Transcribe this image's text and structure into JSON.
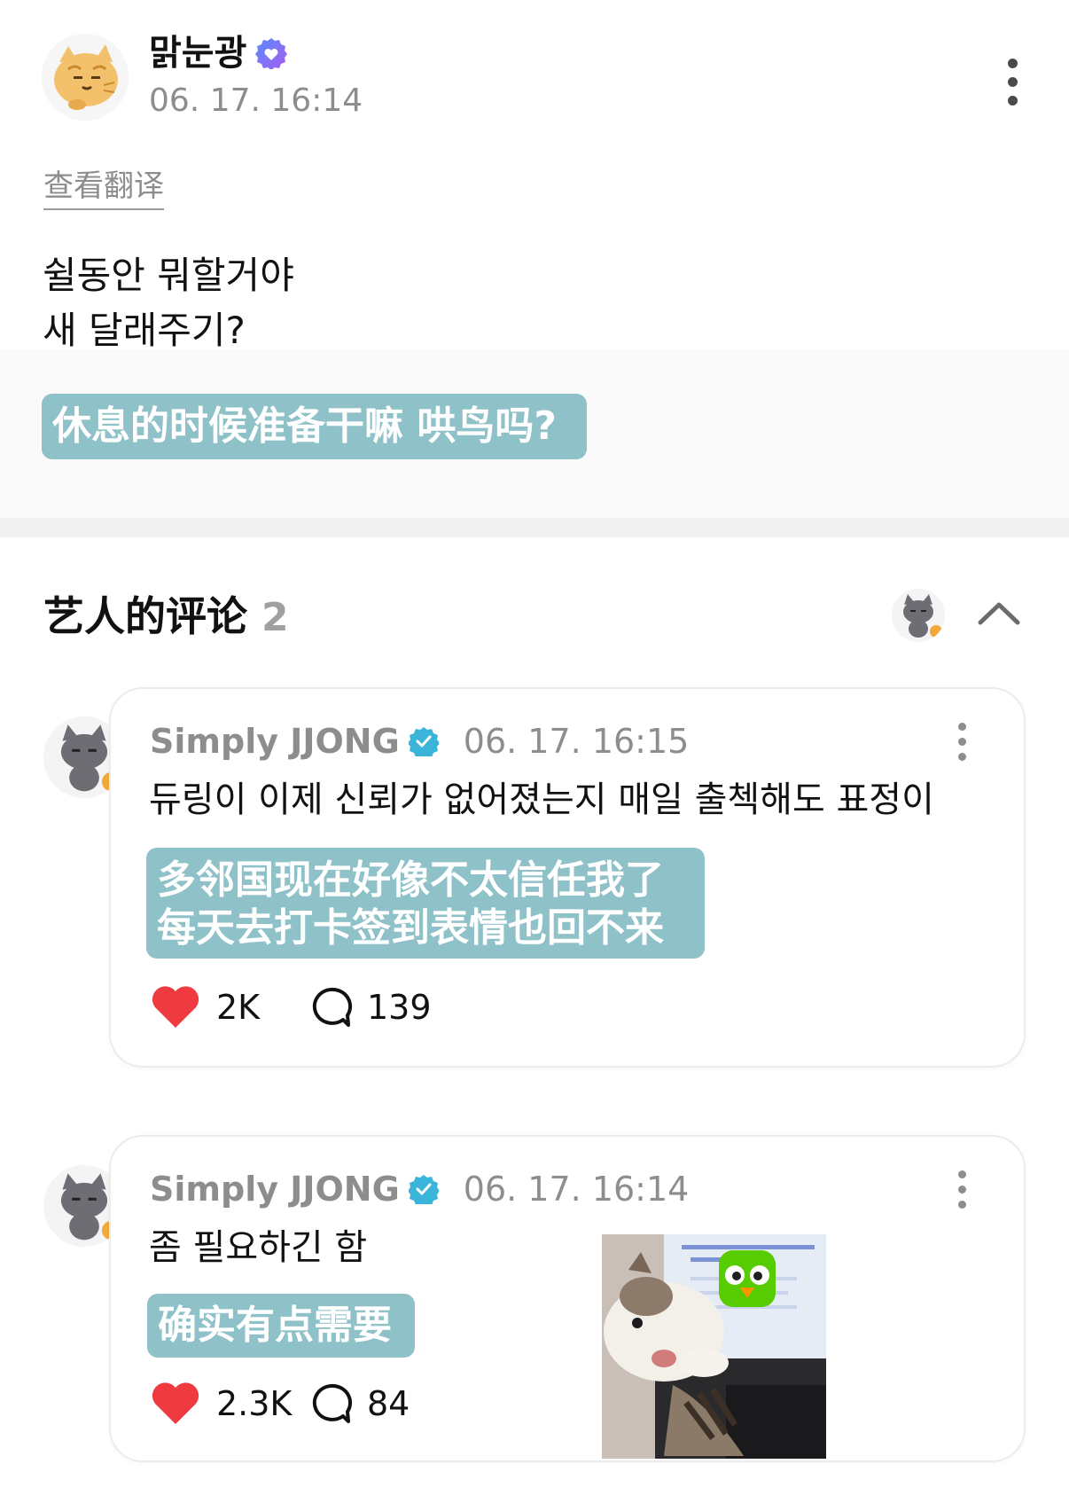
{
  "post": {
    "author": "맑눈광",
    "timestamp": "06. 17. 16:14",
    "translate_link": "查看翻译",
    "text": "쉴동안 뭐할거야\n새 달래주기?",
    "translation": "休息的时候准备干嘛 哄鸟吗?"
  },
  "comments_section": {
    "title": "艺人的评论",
    "count": "2"
  },
  "comments": [
    {
      "author": "Simply JJONG",
      "timestamp": "06. 17. 16:15",
      "text": "듀링이 이제 신뢰가 없어졌는지 매일 출첵해도 표정이",
      "translation": "多邻国现在好像不太信任我了\n每天去打卡签到表情也回不来",
      "likes": "2K",
      "replies": "139"
    },
    {
      "author": "Simply JJONG",
      "timestamp": "06. 17. 16:14",
      "text": "좀 필요하긴 함",
      "translation": "确实有点需要",
      "likes": "2.3K",
      "replies": "84",
      "image_alt": "cat-at-laptop-with-duolingo-owl"
    }
  ],
  "colors": {
    "translation_bg": "#8ec1c8",
    "heart": "#ef3b3f",
    "verified_blue": "#3ab4d8",
    "verified_purple": "#7a5cf0"
  }
}
